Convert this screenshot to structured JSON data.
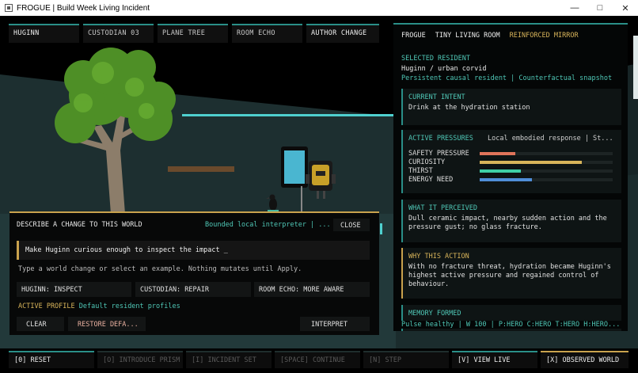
{
  "window": {
    "title": "FROGUE | Build Week Living Incident",
    "icon": "app-icon",
    "controls": [
      "minimize-icon",
      "maximize-icon",
      "close-icon"
    ]
  },
  "top_tabs": [
    {
      "label": "HUGINN",
      "active": true
    },
    {
      "label": "CUSTODIAN 03",
      "active": false
    },
    {
      "label": "PLANE TREE",
      "active": false
    },
    {
      "label": "ROOM ECHO",
      "active": false
    },
    {
      "label": "AUTHOR CHANGE",
      "active": true
    }
  ],
  "right_panel": {
    "brand": "FROGUE",
    "room": "TINY LIVING ROOM",
    "mode": "REINFORCED MIRROR",
    "selected_resident_label": "SELECTED RESIDENT",
    "resident_name": "Huginn / urban corvid",
    "resident_tags": "Persistent causal resident | Counterfactual snapshot",
    "current_intent": {
      "title": "CURRENT INTENT",
      "text": "Drink at the hydration station"
    },
    "active_pressures": {
      "title": "ACTIVE PRESSURES",
      "subtitle": "Local embodied response | St...",
      "items": [
        {
          "label": "SAFETY PRESSURE",
          "level": 0.27,
          "color": "#e0745a"
        },
        {
          "label": "CURIOSITY",
          "level": 0.77,
          "color": "#d8b45a"
        },
        {
          "label": "THIRST",
          "level": 0.31,
          "color": "#3fcfa6"
        },
        {
          "label": "ENERGY NEED",
          "level": 0.39,
          "color": "#4f8ed8"
        }
      ]
    },
    "what_it_perceived": {
      "title": "WHAT IT PERCEIVED",
      "text": "Dull ceramic impact, nearby sudden action and the pressure gust; no glass fracture."
    },
    "why_this_action": {
      "title": "WHY THIS ACTION",
      "text": "With no fracture threat, hydration became Huginn's highest active pressure and regained control of behaviour."
    },
    "memory_formed": {
      "title": "MEMORY FORMED"
    },
    "status_line": "Pulse healthy | W 100 | P:HERO C:HERO T:HERO H:HERO..."
  },
  "dialog": {
    "title": "DESCRIBE A CHANGE TO THIS WORLD",
    "interpreter": "Bounded local interpreter | ...",
    "close_label": "CLOSE",
    "input_value": "Make Huginn curious enough to inspect the impact _",
    "help_text": "Type a world change or select an example. Nothing mutates until Apply.",
    "examples": [
      "HUGINN: INSPECT",
      "CUSTODIAN: REPAIR",
      "ROOM ECHO: MORE AWARE"
    ],
    "profile_label": "ACTIVE PROFILE",
    "profile_value": "Default resident profiles",
    "clear_label": "CLEAR",
    "restore_label": "RESTORE DEFA...",
    "interpret_label": "INTERPRET"
  },
  "bottom_bar": [
    {
      "label": "[0] RESET",
      "state": "on"
    },
    {
      "label": "[O] INTRODUCE PRISM",
      "state": "dim"
    },
    {
      "label": "[I] INCIDENT SET",
      "state": "dim"
    },
    {
      "label": "[SPACE] CONTINUE",
      "state": "dim"
    },
    {
      "label": "[N] STEP",
      "state": "dim"
    },
    {
      "label": "[V] VIEW LIVE",
      "state": "on"
    },
    {
      "label": "[X] OBSERVED WORLD",
      "state": "gold"
    }
  ],
  "colors": {
    "accent_teal": "#2a8f88",
    "accent_gold": "#c9a24d",
    "text_teal": "#4fc7b6"
  }
}
